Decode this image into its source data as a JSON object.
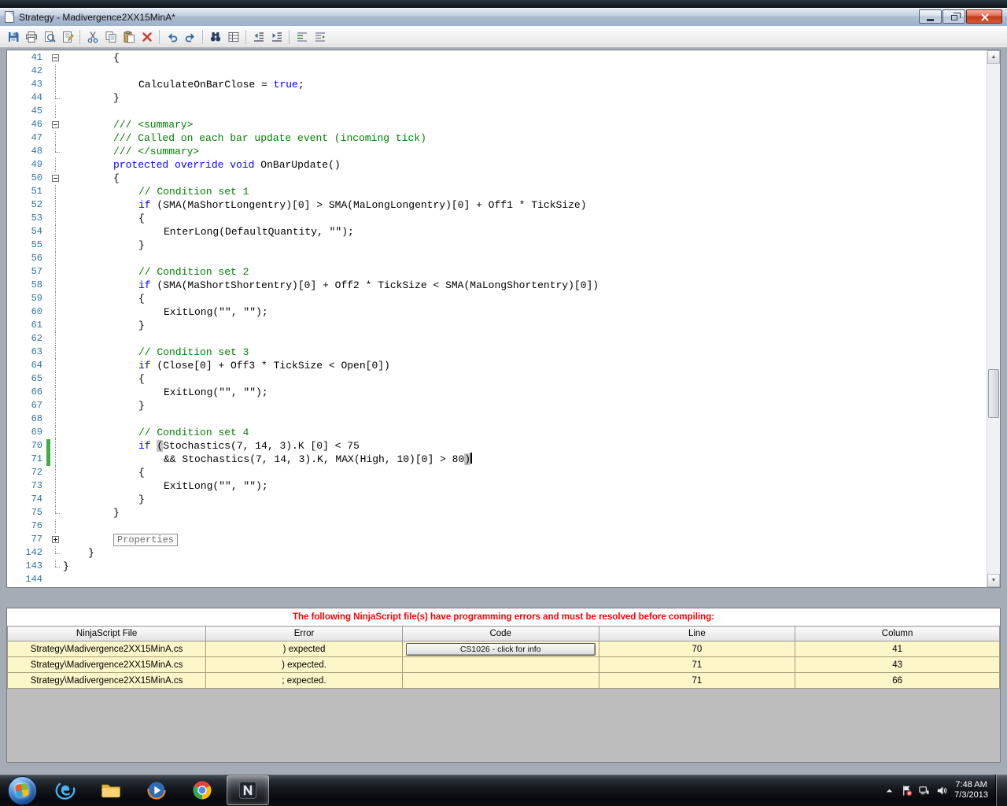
{
  "colors": {
    "keyword": "#0000ff",
    "comment": "#008000",
    "plain-text": "#000000",
    "line-number": "#2f74a7",
    "change-bar": "#3fae49",
    "brace-highlight": "#c6c6c6",
    "error-text": "#ff0000",
    "error-row-bg": "#fdf6c9"
  },
  "window": {
    "title": "Strategy - Madivergence2XX15MinA*",
    "controls": [
      "minimize-button",
      "maximize-button",
      "close-button"
    ]
  },
  "toolbar": {
    "icons": [
      "save-icon",
      "print-icon",
      "print-preview-icon",
      "page-setup-icon",
      "separator",
      "cut-icon",
      "copy-icon",
      "paste-icon",
      "delete-icon",
      "separator",
      "undo-icon",
      "redo-icon",
      "separator",
      "find-icon",
      "bookmark-icon",
      "separator",
      "outdent-icon",
      "indent-icon",
      "separator",
      "comment-icon",
      "uncomment-icon"
    ]
  },
  "editor": {
    "lines": [
      {
        "n": 41,
        "i": 2,
        "f": "minus",
        "s": [
          [
            "p",
            "{"
          ]
        ]
      },
      {
        "n": 42,
        "i": 0,
        "f": "v",
        "s": []
      },
      {
        "n": 43,
        "i": 3,
        "f": "v",
        "s": [
          [
            "p",
            "CalculateOnBarClose = "
          ],
          [
            "k",
            "true"
          ],
          [
            "p",
            ";"
          ]
        ]
      },
      {
        "n": 44,
        "i": 2,
        "f": "end",
        "s": [
          [
            "p",
            "}"
          ]
        ]
      },
      {
        "n": 45,
        "i": 0,
        "f": "v",
        "s": []
      },
      {
        "n": 46,
        "i": 2,
        "f": "minus",
        "s": [
          [
            "c",
            "/// <summary>"
          ]
        ]
      },
      {
        "n": 47,
        "i": 2,
        "f": "v",
        "s": [
          [
            "c",
            "/// Called on each bar update event (incoming tick)"
          ]
        ]
      },
      {
        "n": 48,
        "i": 2,
        "f": "end",
        "s": [
          [
            "c",
            "/// </summary>"
          ]
        ]
      },
      {
        "n": 49,
        "i": 2,
        "f": "v",
        "s": [
          [
            "k",
            "protected"
          ],
          [
            "p",
            " "
          ],
          [
            "k",
            "override"
          ],
          [
            "p",
            " "
          ],
          [
            "k",
            "void"
          ],
          [
            "p",
            " OnBarUpdate()"
          ]
        ]
      },
      {
        "n": 50,
        "i": 2,
        "f": "minus",
        "s": [
          [
            "p",
            "{"
          ]
        ]
      },
      {
        "n": 51,
        "i": 3,
        "f": "v",
        "s": [
          [
            "c",
            "// Condition set 1"
          ]
        ]
      },
      {
        "n": 52,
        "i": 3,
        "f": "v",
        "s": [
          [
            "k",
            "if"
          ],
          [
            "p",
            " (SMA(MaShortLongentry)[0] > SMA(MaLongLongentry)[0] + Off1 * TickSize)"
          ]
        ]
      },
      {
        "n": 53,
        "i": 3,
        "f": "v",
        "s": [
          [
            "p",
            "{"
          ]
        ]
      },
      {
        "n": 54,
        "i": 4,
        "f": "v",
        "s": [
          [
            "p",
            "EnterLong(DefaultQuantity, \"\");"
          ]
        ]
      },
      {
        "n": 55,
        "i": 3,
        "f": "v",
        "s": [
          [
            "p",
            "}"
          ]
        ]
      },
      {
        "n": 56,
        "i": 0,
        "f": "v",
        "s": []
      },
      {
        "n": 57,
        "i": 3,
        "f": "v",
        "s": [
          [
            "c",
            "// Condition set 2"
          ]
        ]
      },
      {
        "n": 58,
        "i": 3,
        "f": "v",
        "s": [
          [
            "k",
            "if"
          ],
          [
            "p",
            " (SMA(MaShortShortentry)[0] + Off2 * TickSize < SMA(MaLongShortentry)[0])"
          ]
        ]
      },
      {
        "n": 59,
        "i": 3,
        "f": "v",
        "s": [
          [
            "p",
            "{"
          ]
        ]
      },
      {
        "n": 60,
        "i": 4,
        "f": "v",
        "s": [
          [
            "p",
            "ExitLong(\"\", \"\");"
          ]
        ]
      },
      {
        "n": 61,
        "i": 3,
        "f": "v",
        "s": [
          [
            "p",
            "}"
          ]
        ]
      },
      {
        "n": 62,
        "i": 0,
        "f": "v",
        "s": []
      },
      {
        "n": 63,
        "i": 3,
        "f": "v",
        "s": [
          [
            "c",
            "// Condition set 3"
          ]
        ]
      },
      {
        "n": 64,
        "i": 3,
        "f": "v",
        "s": [
          [
            "k",
            "if"
          ],
          [
            "p",
            " (Close[0] + Off3 * TickSize < Open[0])"
          ]
        ]
      },
      {
        "n": 65,
        "i": 3,
        "f": "v",
        "s": [
          [
            "p",
            "{"
          ]
        ]
      },
      {
        "n": 66,
        "i": 4,
        "f": "v",
        "s": [
          [
            "p",
            "ExitLong(\"\", \"\");"
          ]
        ]
      },
      {
        "n": 67,
        "i": 3,
        "f": "v",
        "s": [
          [
            "p",
            "}"
          ]
        ]
      },
      {
        "n": 68,
        "i": 0,
        "f": "v",
        "s": []
      },
      {
        "n": 69,
        "i": 3,
        "f": "v",
        "s": [
          [
            "c",
            "// Condition set 4"
          ]
        ]
      },
      {
        "n": 70,
        "i": 3,
        "f": "v",
        "m": true,
        "s": [
          [
            "k",
            "if"
          ],
          [
            "p",
            " "
          ],
          [
            "b",
            "("
          ],
          [
            "p",
            "Stochastics(7, 14, 3).K [0] < 75"
          ]
        ]
      },
      {
        "n": 71,
        "i": 4,
        "f": "v",
        "m": true,
        "s": [
          [
            "p",
            "&& Stochastics(7, 14, 3).K, MAX(High, 10)[0] > 80"
          ],
          [
            "b",
            ")"
          ],
          [
            "caret",
            ""
          ]
        ]
      },
      {
        "n": 72,
        "i": 3,
        "f": "v",
        "s": [
          [
            "p",
            "{"
          ]
        ]
      },
      {
        "n": 73,
        "i": 4,
        "f": "v",
        "s": [
          [
            "p",
            "ExitLong(\"\", \"\");"
          ]
        ]
      },
      {
        "n": 74,
        "i": 3,
        "f": "v",
        "s": [
          [
            "p",
            "}"
          ]
        ]
      },
      {
        "n": 75,
        "i": 2,
        "f": "end",
        "s": [
          [
            "p",
            "}"
          ]
        ]
      },
      {
        "n": 76,
        "i": 0,
        "f": "v",
        "s": []
      },
      {
        "n": 77,
        "i": 2,
        "f": "plus",
        "s": [
          [
            "x",
            "Properties"
          ]
        ]
      },
      {
        "n": 142,
        "i": 1,
        "f": "end",
        "s": [
          [
            "p",
            "}"
          ]
        ]
      },
      {
        "n": 143,
        "i": 0,
        "f": "end",
        "s": [
          [
            "p",
            "}"
          ]
        ]
      },
      {
        "n": 144,
        "i": 0,
        "f": "",
        "s": []
      }
    ]
  },
  "error_panel": {
    "message": "The following NinjaScript file(s) have programming errors and must be resolved before compiling:",
    "columns": [
      "NinjaScript File",
      "Error",
      "Code",
      "Line",
      "Column"
    ],
    "rows": [
      {
        "file": "Strategy\\Madivergence2XX15MinA.cs",
        "error": ") expected",
        "code": "CS1026 - click for info",
        "line": "70",
        "column": "41"
      },
      {
        "file": "Strategy\\Madivergence2XX15MinA.cs",
        "error": ") expected.",
        "code": "",
        "line": "71",
        "column": "43"
      },
      {
        "file": "Strategy\\Madivergence2XX15MinA.cs",
        "error": "; expected.",
        "code": "",
        "line": "71",
        "column": "66"
      }
    ]
  },
  "taskbar": {
    "apps": [
      {
        "name": "start-button"
      },
      {
        "name": "internet-explorer-icon"
      },
      {
        "name": "windows-explorer-icon"
      },
      {
        "name": "media-player-icon"
      },
      {
        "name": "chrome-icon"
      },
      {
        "name": "ninjatrader-icon",
        "active": true
      }
    ],
    "tray_icons": [
      "hidden-icons-arrow",
      "action-center-flag-icon",
      "network-icon",
      "volume-icon"
    ],
    "clock": {
      "time": "7:48 AM",
      "date": "7/3/2013"
    }
  }
}
